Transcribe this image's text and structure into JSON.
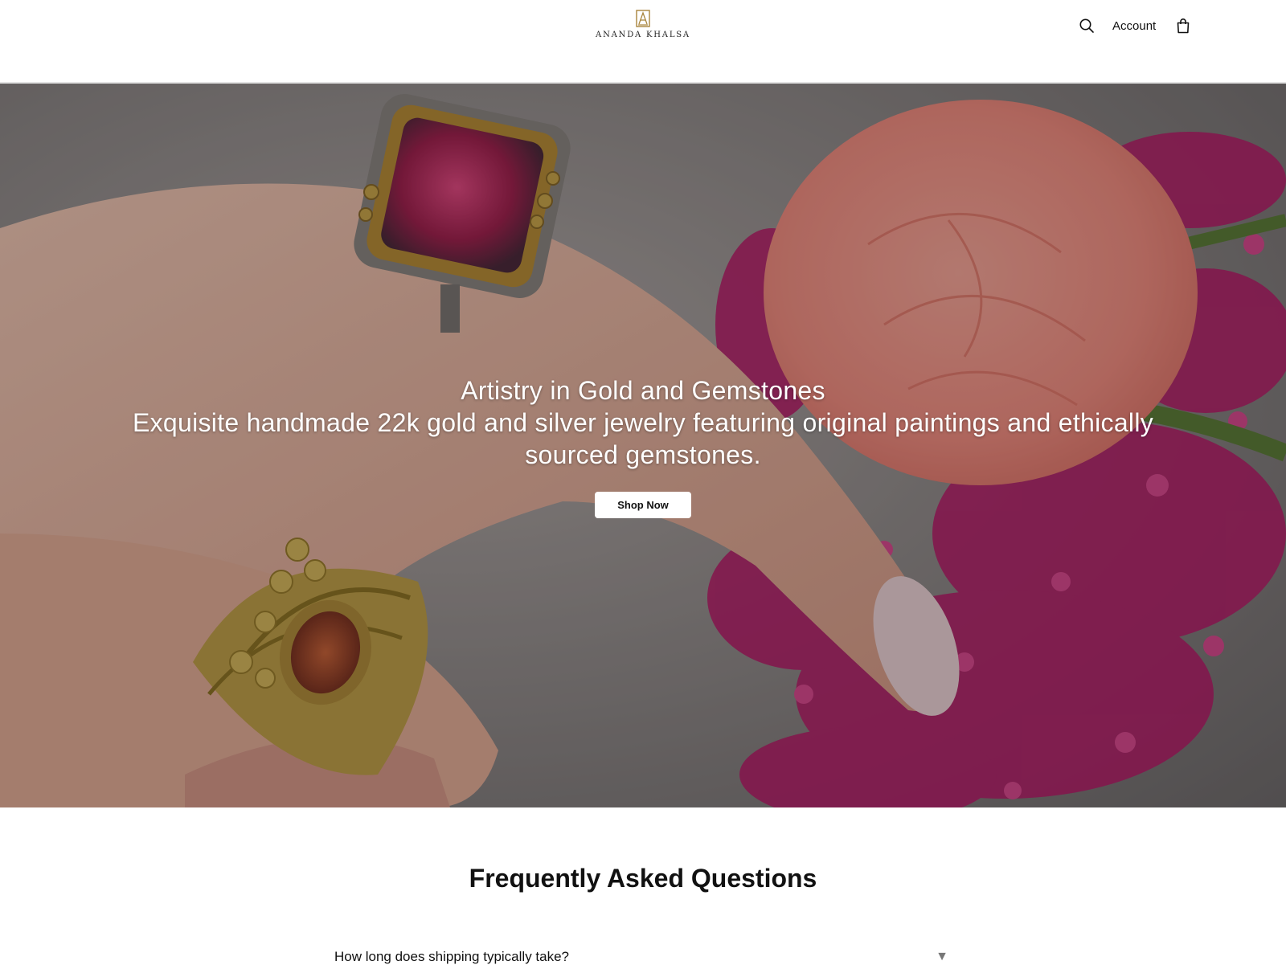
{
  "header": {
    "logo_text": "ANANDA KHALSA",
    "account_label": "Account",
    "icons": {
      "search": "search-icon",
      "cart": "shopping-bag-icon",
      "logo": "logo-mark-icon"
    }
  },
  "hero": {
    "title": "Artistry in Gold and Gemstones",
    "subtitle": "Exquisite handmade 22k gold and silver jewelry featuring original paintings and ethically sourced gemstones.",
    "cta_label": "Shop Now"
  },
  "faq": {
    "title": "Frequently Asked Questions",
    "items": [
      {
        "question": "How long does shipping typically take?",
        "expand_icon": "▼"
      }
    ]
  },
  "colors": {
    "accent_gold": "#a8843c",
    "hero_overlay": "rgba(0,0,0,0.28)",
    "text": "#111111"
  }
}
